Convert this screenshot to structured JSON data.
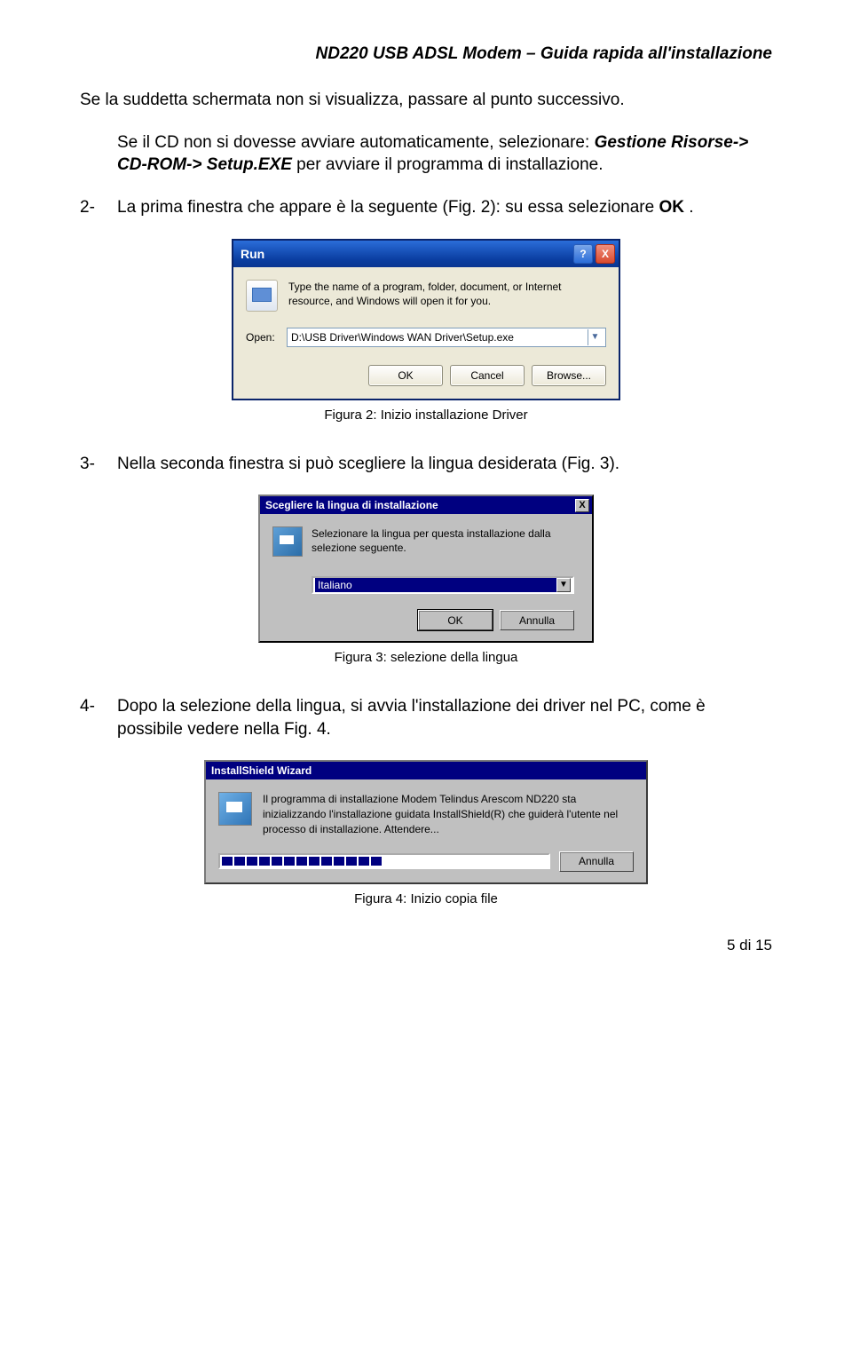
{
  "header": {
    "title": "ND220 USB ADSL Modem – Guida rapida all'installazione"
  },
  "para1": "Se la suddetta schermata non si visualizza, passare al punto successivo.",
  "para2_pre": "Se il CD non si dovesse avviare automaticamente, selezionare: ",
  "para2_bold": "Gestione Risorse-> CD-ROM-> Setup.EXE ",
  "para2_post": " per avviare il programma di installazione.",
  "item2_num": "2-",
  "item2_text_pre": "La prima finestra che appare è la seguente (Fig. 2): su essa selezionare ",
  "item2_text_bold": "OK",
  "item2_text_post": ".",
  "run": {
    "title": "Run",
    "help": "?",
    "close": "X",
    "desc": "Type the name of a program, folder, document, or Internet resource, and Windows will open it for you.",
    "open_label": "Open:",
    "open_value": "D:\\USB Driver\\Windows WAN Driver\\Setup.exe",
    "ok": "OK",
    "cancel": "Cancel",
    "browse": "Browse..."
  },
  "cap2": "Figura 2: Inizio installazione Driver",
  "item3_num": "3-",
  "item3_text": "Nella seconda finestra si può scegliere la lingua desiderata (Fig. 3).",
  "lang": {
    "title": "Scegliere la lingua di installazione",
    "close": "X",
    "desc": "Selezionare la lingua per questa installazione dalla selezione seguente.",
    "value": "Italiano",
    "ok": "OK",
    "cancel": "Annulla"
  },
  "cap3": "Figura 3: selezione della lingua",
  "item4_num": "4-",
  "item4_text": "Dopo la selezione della lingua, si avvia l'installazione dei driver nel PC, come è possibile vedere nella Fig. 4.",
  "is": {
    "title": "InstallShield Wizard",
    "desc": "Il programma di installazione Modem Telindus Arescom ND220 sta inizializzando l'installazione guidata InstallShield(R) che guiderà l'utente nel processo di installazione. Attendere...",
    "cancel": "Annulla"
  },
  "cap4": "Figura 4: Inizio copia file",
  "pagenum": "5 di  15",
  "chev_down": "▼"
}
